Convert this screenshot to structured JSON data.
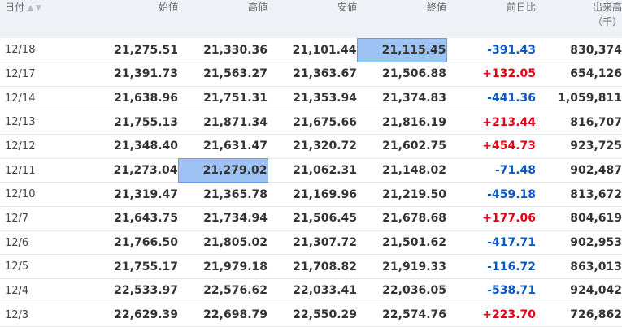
{
  "headers": {
    "date": "日付",
    "open": "始値",
    "high": "高値",
    "low": "安値",
    "close": "終値",
    "change": "前日比",
    "volume": "出来高",
    "volume_unit": "（千）"
  },
  "colors": {
    "positive": "#e60012",
    "negative": "#0a58c6",
    "highlight": "#9cc3f4",
    "header_bg": "#eef1f6"
  },
  "rows": [
    {
      "date": "12/18",
      "open": "21,275.51",
      "high": "21,330.36",
      "low": "21,101.44",
      "close": "21,115.45",
      "change": "-391.43",
      "volume": "830,374"
    },
    {
      "date": "12/17",
      "open": "21,391.73",
      "high": "21,563.27",
      "low": "21,363.67",
      "close": "21,506.88",
      "change": "+132.05",
      "volume": "654,126"
    },
    {
      "date": "12/14",
      "open": "21,638.96",
      "high": "21,751.31",
      "low": "21,353.94",
      "close": "21,374.83",
      "change": "-441.36",
      "volume": "1,059,811"
    },
    {
      "date": "12/13",
      "open": "21,755.13",
      "high": "21,871.34",
      "low": "21,675.66",
      "close": "21,816.19",
      "change": "+213.44",
      "volume": "816,707"
    },
    {
      "date": "12/12",
      "open": "21,348.40",
      "high": "21,631.47",
      "low": "21,320.72",
      "close": "21,602.75",
      "change": "+454.73",
      "volume": "923,725"
    },
    {
      "date": "12/11",
      "open": "21,273.04",
      "high": "21,279.02",
      "low": "21,062.31",
      "close": "21,148.02",
      "change": "-71.48",
      "volume": "902,487"
    },
    {
      "date": "12/10",
      "open": "21,319.47",
      "high": "21,365.78",
      "low": "21,169.96",
      "close": "21,219.50",
      "change": "-459.18",
      "volume": "813,672"
    },
    {
      "date": "12/7",
      "open": "21,643.75",
      "high": "21,734.94",
      "low": "21,506.45",
      "close": "21,678.68",
      "change": "+177.06",
      "volume": "804,619"
    },
    {
      "date": "12/6",
      "open": "21,766.50",
      "high": "21,805.02",
      "low": "21,307.72",
      "close": "21,501.62",
      "change": "-417.71",
      "volume": "902,953"
    },
    {
      "date": "12/5",
      "open": "21,755.17",
      "high": "21,979.18",
      "low": "21,708.82",
      "close": "21,919.33",
      "change": "-116.72",
      "volume": "863,013"
    },
    {
      "date": "12/4",
      "open": "22,533.97",
      "high": "22,576.62",
      "low": "22,033.41",
      "close": "22,036.05",
      "change": "-538.71",
      "volume": "924,042"
    },
    {
      "date": "12/3",
      "open": "22,629.39",
      "high": "22,698.79",
      "low": "22,550.29",
      "close": "22,574.76",
      "change": "+223.70",
      "volume": "726,862"
    }
  ]
}
